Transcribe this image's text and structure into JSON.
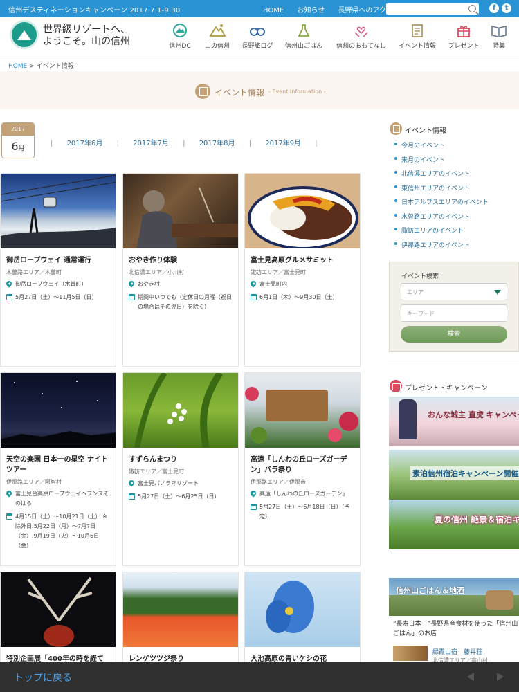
{
  "topbar": {
    "campaign": "信州デスティネーションキャンペーン 2017.7.1-9.30",
    "links": [
      "HOME",
      "お知らせ",
      "長野県へのアクセス"
    ],
    "search_placeholder": "",
    "sns": [
      "f",
      "t"
    ]
  },
  "header": {
    "logo_line1": "世界級リゾートへ、",
    "logo_line2": "ようこそ。山の信州",
    "nav": [
      {
        "label": "信州DC",
        "icon": "mountain-badge-icon",
        "color": "#2ba89a"
      },
      {
        "label": "山の信州",
        "icon": "mountain-icon",
        "color": "#b09a3a"
      },
      {
        "label": "長野旅ログ",
        "icon": "binoculars-icon",
        "color": "#3b6fa8"
      },
      {
        "label": "信州山ごはん",
        "icon": "flask-icon",
        "color": "#8aa84a"
      },
      {
        "label": "信州のおもてなし",
        "icon": "hands-heart-icon",
        "color": "#d45a8a"
      },
      {
        "label": "イベント情報",
        "icon": "calendar-icon",
        "color": "#b09a6a"
      },
      {
        "label": "プレゼント",
        "icon": "gift-icon",
        "color": "#d84a5e"
      },
      {
        "label": "特集",
        "icon": "book-icon",
        "color": "#6a7a8a"
      }
    ]
  },
  "breadcrumb": {
    "home": "HOME",
    "sep": ">",
    "current": "イベント情報"
  },
  "banner": {
    "title": "イベント情報",
    "subtitle": "- Event Information -"
  },
  "calendar": {
    "year": "2017",
    "month": "6",
    "month_suffix": "月"
  },
  "months": [
    "2017年6月",
    "2017年7月",
    "2017年8月",
    "2017年9月"
  ],
  "events": [
    {
      "title": "御岳ロープウェイ 通常運行",
      "area": "木曽路エリア／木曽町",
      "place": "御岳ロープウェイ（木曽町）",
      "date": "5月27日（土）〜11月5日（日）"
    },
    {
      "title": "おやき作り体験",
      "area": "北信濃エリア／小川村",
      "place": "おやき村",
      "date": "期間中いつでも（定休日の月曜（祝日の場合はその翌日）を除く）"
    },
    {
      "title": "富士見高原グルメサミット",
      "area": "諏訪エリア／富士見町",
      "place": "富士見町内",
      "date": "6月1日（木）〜9月30日（土）"
    },
    {
      "title": "天空の楽園 日本一の星空 ナイトツアー",
      "area": "伊那路エリア／阿智村",
      "place": "富士見台高原ロープウェイヘブンスそのはら",
      "date": "4月15日（土）〜10月21日（土） ※除外日:5月22日（月）〜7月7日（金）.9月19日（火）〜10月6日（金）"
    },
    {
      "title": "すずらんまつり",
      "area": "諏訪エリア／富士見町",
      "place": "富士見パノラマリゾート",
      "date": "5月27日（土）〜6月25日（日）"
    },
    {
      "title": "高遠「しんわの丘ローズガーデン」バラ祭り",
      "area": "伊那路エリア／伊那市",
      "place": "高遠「しんわの丘ローズガーデン」",
      "date": "5月27日（土）〜6月18日（日）（予定）"
    },
    {
      "title": "特別企画展「400年の時を経て",
      "area": "",
      "place": "",
      "date": ""
    },
    {
      "title": "レンゲツツジ祭り",
      "area": "",
      "place": "",
      "date": ""
    },
    {
      "title": "大池高原の青いケシの花",
      "area": "",
      "place": "",
      "date": ""
    }
  ],
  "sidebar": {
    "events_title": "イベント情報",
    "links": [
      "今月のイベント",
      "来月のイベント",
      "北信濃エリアのイベント",
      "東信州エリアのイベント",
      "日本アルプスエリアのイベント",
      "木曽路エリアのイベント",
      "諏訪エリアのイベント",
      "伊那路エリアのイベント"
    ],
    "search": {
      "title": "イベント検索",
      "area_placeholder": "エリア",
      "keyword_placeholder": "キーワード",
      "button": "検索"
    },
    "present_title": "プレゼント・キャンペーン",
    "promos": [
      {
        "text": "おんな城主 直虎 キャンペーン"
      },
      {
        "text": "素泊信州宿泊キャンペーン開催中"
      },
      {
        "text": "夏の信州 絶景＆宿泊キャンペーン"
      }
    ],
    "gohan": {
      "banner": "信州山ごはん＆地酒",
      "caption": "“長寿日本一”長野県産食材を使った「信州山ごはん」のお店",
      "item_name": "緑霞山宿　藤井荘",
      "item_area": "北信濃エリア／高山村"
    }
  },
  "bottombar": {
    "back": "トップに戻る"
  }
}
